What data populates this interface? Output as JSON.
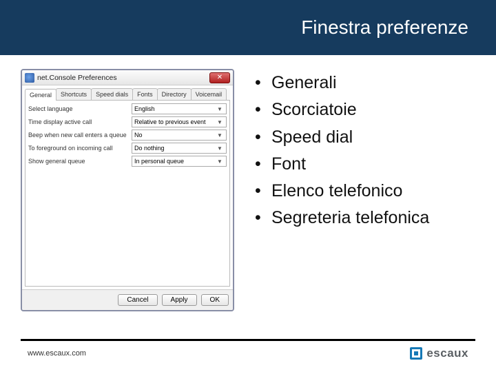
{
  "header": {
    "title": "Finestra preferenze"
  },
  "dialog": {
    "title": "net.Console Preferences",
    "tabs": [
      {
        "label": "General",
        "active": true
      },
      {
        "label": "Shortcuts"
      },
      {
        "label": "Speed dials"
      },
      {
        "label": "Fonts"
      },
      {
        "label": "Directory"
      },
      {
        "label": "Voicemail"
      }
    ],
    "rows": [
      {
        "label": "Select language",
        "value": "English"
      },
      {
        "label": "Time display active call",
        "value": "Relative to previous event"
      },
      {
        "label": "Beep when new call enters a queue",
        "value": "No"
      },
      {
        "label": "To foreground on incoming call",
        "value": "Do nothing"
      },
      {
        "label": "Show general queue",
        "value": "In personal queue"
      }
    ],
    "buttons": {
      "cancel": "Cancel",
      "apply": "Apply",
      "ok": "OK"
    }
  },
  "bullets": [
    "Generali",
    "Scorciatoie",
    "Speed dial",
    "Font",
    "Elenco telefonico",
    "Segreteria telefonica"
  ],
  "footer": {
    "url": "www.escaux.com",
    "brand": "escaux"
  }
}
